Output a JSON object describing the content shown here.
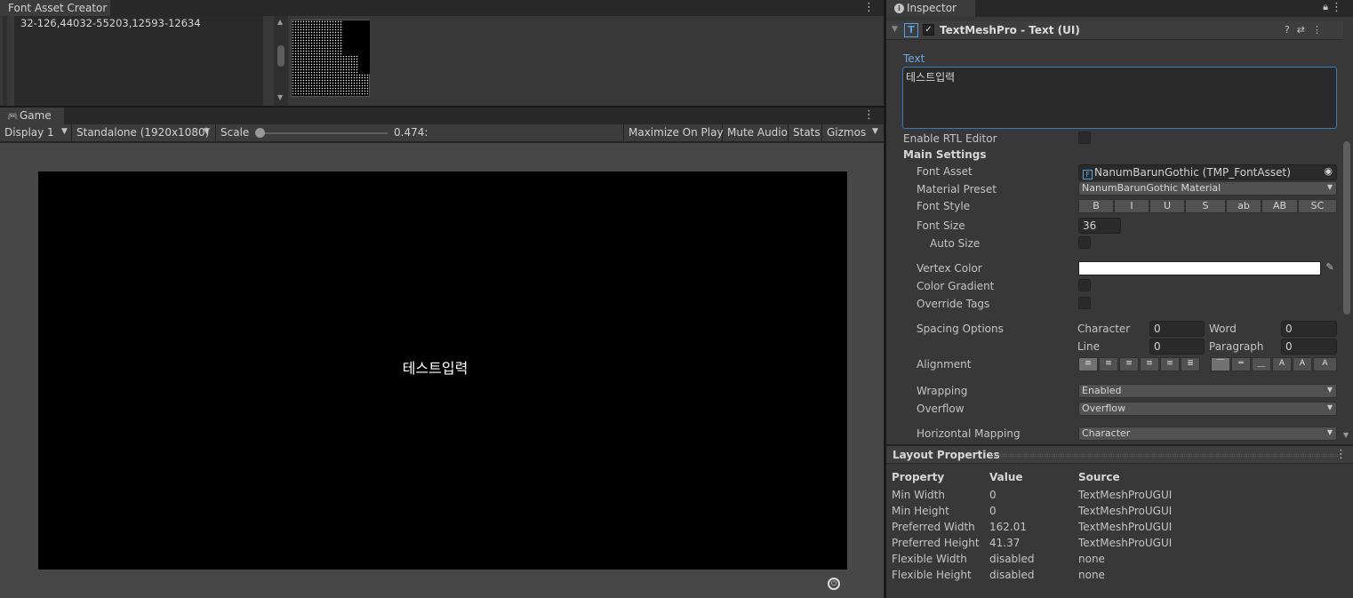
{
  "font_asset_creator": {
    "tab_label": "Font Asset Creator",
    "character_ranges": "32-126,44032-55203,12593-12634"
  },
  "game": {
    "tab_label": "Game",
    "toolbar": {
      "display": "Display 1",
      "resolution": "Standalone (1920x1080)",
      "scale_label": "Scale",
      "scale_value": "0.474:",
      "maximize": "Maximize On Play",
      "mute": "Mute Audio",
      "stats": "Stats",
      "gizmos": "Gizmos"
    },
    "screen_text": "테스트입력"
  },
  "inspector": {
    "tab_label": "Inspector",
    "component_title": "TextMeshPro - Text (UI)",
    "text_label": "Text",
    "text_value": "테스트입력",
    "enable_rtl": "Enable RTL Editor",
    "main_settings": "Main Settings",
    "font_asset_label": "Font Asset",
    "font_asset_value": "NanumBarunGothic (TMP_FontAsset)",
    "material_preset_label": "Material Preset",
    "material_preset_value": "NanumBarunGothic Material",
    "font_style_label": "Font Style",
    "font_style_buttons": [
      "B",
      "I",
      "U",
      "S",
      "ab",
      "AB",
      "SC"
    ],
    "font_size_label": "Font Size",
    "font_size_value": "36",
    "auto_size": "Auto Size",
    "vertex_color": "Vertex Color",
    "vertex_color_value": "#ffffff",
    "color_gradient": "Color Gradient",
    "override_tags": "Override Tags",
    "spacing_options": "Spacing Options",
    "spacing": {
      "character_label": "Character",
      "character_value": "0",
      "word_label": "Word",
      "word_value": "0",
      "line_label": "Line",
      "line_value": "0",
      "paragraph_label": "Paragraph",
      "paragraph_value": "0"
    },
    "alignment": "Alignment",
    "wrapping_label": "Wrapping",
    "wrapping_value": "Enabled",
    "overflow_label": "Overflow",
    "overflow_value": "Overflow",
    "horizontal_mapping_label": "Horizontal Mapping",
    "horizontal_mapping_value": "Character"
  },
  "layout_properties": {
    "title": "Layout Properties",
    "columns": [
      "Property",
      "Value",
      "Source"
    ],
    "rows": [
      [
        "Min Width",
        "0",
        "TextMeshProUGUI"
      ],
      [
        "Min Height",
        "0",
        "TextMeshProUGUI"
      ],
      [
        "Preferred Width",
        "162.01",
        "TextMeshProUGUI"
      ],
      [
        "Preferred Height",
        "41.37",
        "TextMeshProUGUI"
      ],
      [
        "Flexible Width",
        "disabled",
        "none"
      ],
      [
        "Flexible Height",
        "disabled",
        "none"
      ]
    ]
  }
}
